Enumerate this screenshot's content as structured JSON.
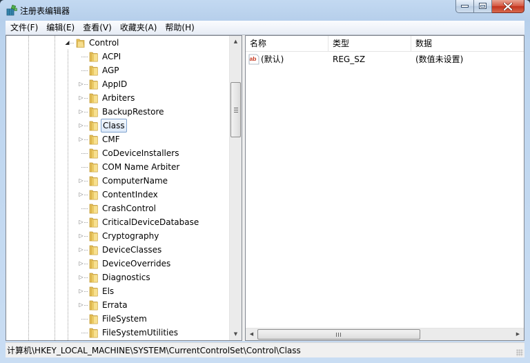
{
  "window": {
    "title": "注册表编辑器",
    "controls": {
      "minimize": "minimize",
      "maximize": "maximize",
      "close": "close"
    }
  },
  "menubar": {
    "items": [
      "文件(F)",
      "编辑(E)",
      "查看(V)",
      "收藏夹(A)",
      "帮助(H)"
    ]
  },
  "tree": {
    "parent": {
      "label": "Control",
      "expanded": true
    },
    "children": [
      {
        "label": "ACPI",
        "has_children": false
      },
      {
        "label": "AGP",
        "has_children": false
      },
      {
        "label": "AppID",
        "has_children": true
      },
      {
        "label": "Arbiters",
        "has_children": true
      },
      {
        "label": "BackupRestore",
        "has_children": true
      },
      {
        "label": "Class",
        "has_children": true,
        "selected": true
      },
      {
        "label": "CMF",
        "has_children": true
      },
      {
        "label": "CoDeviceInstallers",
        "has_children": false
      },
      {
        "label": "COM Name Arbiter",
        "has_children": false
      },
      {
        "label": "ComputerName",
        "has_children": true
      },
      {
        "label": "ContentIndex",
        "has_children": true
      },
      {
        "label": "CrashControl",
        "has_children": false
      },
      {
        "label": "CriticalDeviceDatabase",
        "has_children": true
      },
      {
        "label": "Cryptography",
        "has_children": true
      },
      {
        "label": "DeviceClasses",
        "has_children": true
      },
      {
        "label": "DeviceOverrides",
        "has_children": true
      },
      {
        "label": "Diagnostics",
        "has_children": true
      },
      {
        "label": "Els",
        "has_children": true
      },
      {
        "label": "Errata",
        "has_children": true
      },
      {
        "label": "FileSystem",
        "has_children": false
      },
      {
        "label": "FileSystemUtilities",
        "has_children": false
      }
    ]
  },
  "values_list": {
    "columns": [
      "名称",
      "类型",
      "数据"
    ],
    "rows": [
      {
        "icon": "reg-sz-icon",
        "name": "(默认)",
        "type": "REG_SZ",
        "data": "(数值未设置)"
      }
    ]
  },
  "statusbar": {
    "path": "计算机\\HKEY_LOCAL_MACHINE\\SYSTEM\\CurrentControlSet\\Control\\Class"
  },
  "colors": {
    "selection_border": "#7da2ce",
    "close_button": "#c7432b",
    "title_gradient": "#c3d9f1"
  }
}
